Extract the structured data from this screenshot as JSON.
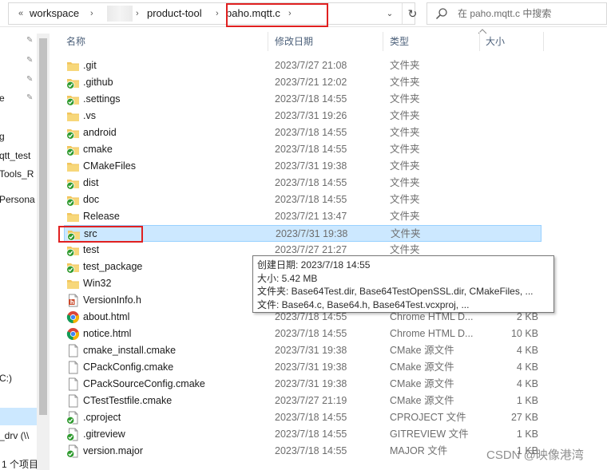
{
  "address": {
    "back_chevrons": "«",
    "segments": [
      "workspace",
      "product-tool",
      "paho.mqtt.c"
    ],
    "sep": "›",
    "dropdown": "⌄",
    "refresh": "↻"
  },
  "search": {
    "placeholder": "在 paho.mqtt.c 中搜索"
  },
  "nav": {
    "items": [
      "e",
      "g",
      "qtt_test",
      "Tools_R",
      "Persona",
      "C:)",
      "_drv (\\\\"
    ],
    "status": "1 个项目"
  },
  "columns": {
    "name": "名称",
    "date": "修改日期",
    "type": "类型",
    "size": "大小"
  },
  "files": [
    {
      "name": ".git",
      "date": "2023/7/27 21:08",
      "type": "文件夹",
      "size": "",
      "icon": "folder-icon"
    },
    {
      "name": ".github",
      "date": "2023/7/21 12:02",
      "type": "文件夹",
      "size": "",
      "icon": "folder-synced-icon"
    },
    {
      "name": ".settings",
      "date": "2023/7/18 14:55",
      "type": "文件夹",
      "size": "",
      "icon": "folder-synced-icon"
    },
    {
      "name": ".vs",
      "date": "2023/7/31 19:26",
      "type": "文件夹",
      "size": "",
      "icon": "folder-icon"
    },
    {
      "name": "android",
      "date": "2023/7/18 14:55",
      "type": "文件夹",
      "size": "",
      "icon": "folder-synced-icon"
    },
    {
      "name": "cmake",
      "date": "2023/7/18 14:55",
      "type": "文件夹",
      "size": "",
      "icon": "folder-synced-icon"
    },
    {
      "name": "CMakeFiles",
      "date": "2023/7/31 19:38",
      "type": "文件夹",
      "size": "",
      "icon": "folder-icon"
    },
    {
      "name": "dist",
      "date": "2023/7/18 14:55",
      "type": "文件夹",
      "size": "",
      "icon": "folder-synced-icon"
    },
    {
      "name": "doc",
      "date": "2023/7/18 14:55",
      "type": "文件夹",
      "size": "",
      "icon": "folder-synced-icon"
    },
    {
      "name": "Release",
      "date": "2023/7/21 13:47",
      "type": "文件夹",
      "size": "",
      "icon": "folder-icon"
    },
    {
      "name": "src",
      "date": "2023/7/31 19:38",
      "type": "文件夹",
      "size": "",
      "icon": "folder-synced-icon",
      "selected": true
    },
    {
      "name": "test",
      "date": "2023/7/27 21:27",
      "type": "文件夹",
      "size": "",
      "icon": "folder-synced-icon"
    },
    {
      "name": "test_package",
      "date": "",
      "type": "",
      "size": "",
      "icon": "folder-synced-icon"
    },
    {
      "name": "Win32",
      "date": "",
      "type": "",
      "size": "",
      "icon": "folder-icon"
    },
    {
      "name": "VersionInfo.h",
      "date": "",
      "type": "",
      "size": "",
      "icon": "header-file-icon"
    },
    {
      "name": "about.html",
      "date": "2023/7/18 14:55",
      "type": "Chrome HTML D...",
      "size": "2 KB",
      "icon": "chrome-html-icon"
    },
    {
      "name": "notice.html",
      "date": "2023/7/18 14:55",
      "type": "Chrome HTML D...",
      "size": "10 KB",
      "icon": "chrome-html-icon"
    },
    {
      "name": "cmake_install.cmake",
      "date": "2023/7/31 19:38",
      "type": "CMake 源文件",
      "size": "4 KB",
      "icon": "file-icon"
    },
    {
      "name": "CPackConfig.cmake",
      "date": "2023/7/31 19:38",
      "type": "CMake 源文件",
      "size": "4 KB",
      "icon": "file-icon"
    },
    {
      "name": "CPackSourceConfig.cmake",
      "date": "2023/7/31 19:38",
      "type": "CMake 源文件",
      "size": "4 KB",
      "icon": "file-icon"
    },
    {
      "name": "CTestTestfile.cmake",
      "date": "2023/7/27 21:19",
      "type": "CMake 源文件",
      "size": "1 KB",
      "icon": "file-icon"
    },
    {
      "name": ".cproject",
      "date": "2023/7/18 14:55",
      "type": "CPROJECT 文件",
      "size": "27 KB",
      "icon": "file-synced-icon"
    },
    {
      "name": ".gitreview",
      "date": "2023/7/18 14:55",
      "type": "GITREVIEW 文件",
      "size": "1 KB",
      "icon": "file-synced-icon"
    },
    {
      "name": "version.major",
      "date": "2023/7/18 14:55",
      "type": "MAJOR 文件",
      "size": "1 KB",
      "icon": "file-synced-icon"
    }
  ],
  "tooltip": {
    "created": "创建日期: 2023/7/18 14:55",
    "size": "大小: 5.42 MB",
    "folders": "文件夹: Base64Test.dir, Base64TestOpenSSL.dir, CMakeFiles, ...",
    "files": "文件: Base64.c, Base64.h, Base64Test.vcxproj, ..."
  },
  "watermark": "CSDN @映像港湾",
  "colors": {
    "selection": "#cce8ff",
    "highlight_box": "#e02020",
    "sync_badge": "#2e9a2e",
    "folder": "#f2c55c"
  }
}
